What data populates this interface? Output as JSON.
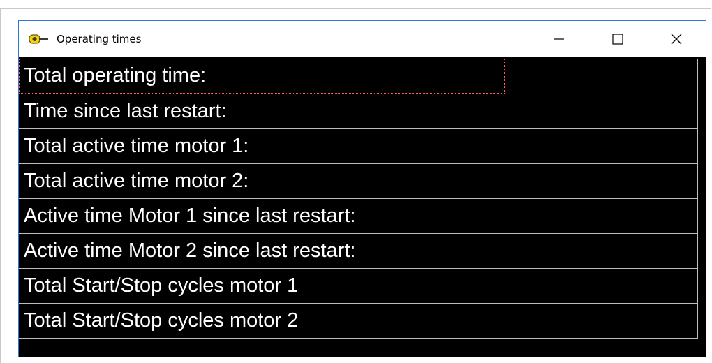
{
  "window": {
    "title": "Operating times",
    "app_icon": "camera-lens-icon",
    "controls": {
      "minimize": "minimize-icon",
      "maximize": "maximize-icon",
      "close": "close-icon"
    }
  },
  "colors": {
    "background": "#000000",
    "text": "#ffffff",
    "grid_line": "#bdbdbd",
    "title_bar": "#ffffff",
    "window_border": "#2b79d0",
    "focus_outline": "#ff5a5a",
    "icon_yellow": "#f2d21b"
  },
  "rows": [
    {
      "label": "Total operating time:",
      "value": ""
    },
    {
      "label": "Time since last restart:",
      "value": ""
    },
    {
      "label": "Total active time motor 1:",
      "value": ""
    },
    {
      "label": "Total active time motor 2:",
      "value": ""
    },
    {
      "label": "Active time Motor 1 since last restart:",
      "value": ""
    },
    {
      "label": "Active time Motor 2 since last restart:",
      "value": ""
    },
    {
      "label": "Total Start/Stop cycles motor 1",
      "value": ""
    },
    {
      "label": "Total Start/Stop cycles motor 2",
      "value": ""
    }
  ]
}
